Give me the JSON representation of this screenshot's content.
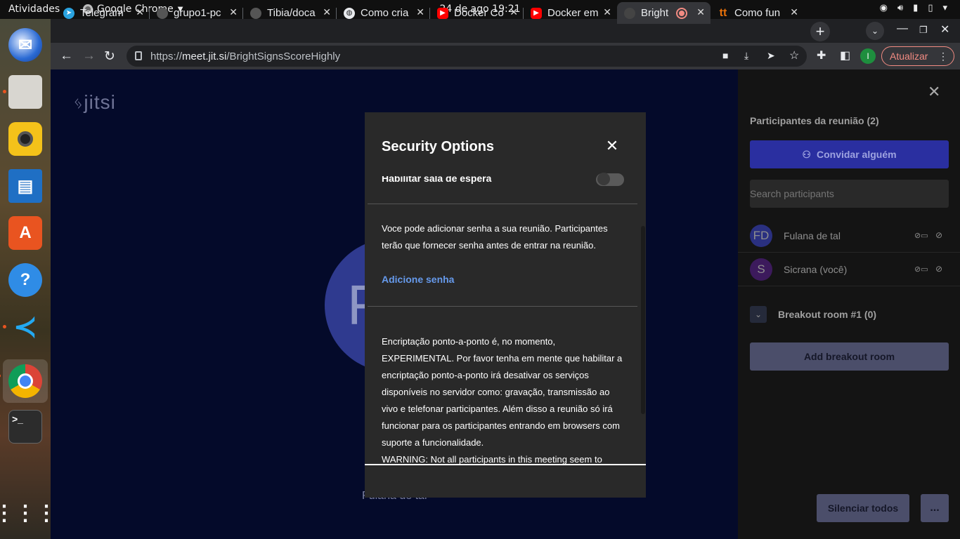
{
  "topbar": {
    "activities": "Atividades",
    "app_name": "Google Chrome",
    "clock": "24 de ago  19:21",
    "icons": [
      "wifi-icon",
      "volume-icon",
      "microphone-icon",
      "battery-icon",
      "power-menu-icon"
    ]
  },
  "dock": {
    "items": [
      "thunderbird",
      "files",
      "rhythmbox",
      "libreoffice-writer",
      "ubuntu-software",
      "help",
      "vscode",
      "chrome",
      "terminal",
      "show-apps"
    ]
  },
  "browser": {
    "tabs": [
      {
        "title": "Telegram",
        "icon": "telegram-icon",
        "icon_color": "#2aa3e0"
      },
      {
        "title": "grupo1-pc",
        "icon": "github-icon",
        "icon_color": "#555555"
      },
      {
        "title": "Tibia/doca",
        "icon": "github-icon",
        "icon_color": "#555555"
      },
      {
        "title": "Como cria",
        "icon": "globe-icon",
        "icon_color": "#e8eaed"
      },
      {
        "title": "Docker Co",
        "icon": "youtube-icon",
        "icon_color": "#ff0000"
      },
      {
        "title": "Docker em",
        "icon": "youtube-icon",
        "icon_color": "#ff0000"
      },
      {
        "title": "Bright",
        "icon": "jitsi-icon",
        "icon_color": "#444444",
        "active": true,
        "recording": true
      },
      {
        "title": "Como fun",
        "icon": "tt-icon",
        "icon_color": "#e8710a"
      }
    ],
    "url_scheme": "https://",
    "url_host": "meet.jit.si",
    "url_path": "/BrightSignsScoreHighly",
    "profile_initial": "I",
    "update_label": "Atualizar"
  },
  "meeting": {
    "logo": "jitsi",
    "avatar_initial": "F",
    "tile_name": "Fulana de tal"
  },
  "security_dialog": {
    "title": "Security Options",
    "lobby_label": "Habilitar sala de espera",
    "lobby_enabled": false,
    "password_text": "Voce pode adicionar senha a sua reunião. Participantes terão que fornecer senha antes de entrar na reunião.",
    "add_password": "Adicione senha",
    "e2ee_text": "Encriptação ponto-a-ponto é, no momento, EXPERIMENTAL. Por favor tenha em mente que habilitar a encriptação ponto-a-ponto irá desativar os serviços disponíveis no servidor como: gravação, transmissão ao vivo e telefonar participantes. Além disso a reunião só irá funcionar para os participantes entrando em browsers com suporte a funcionalidade.",
    "warning_text": "WARNING: Not all participants in this meeting seem to"
  },
  "participants_panel": {
    "title": "Participantes da reunião (2)",
    "invite_label": "Convidar alguém",
    "search_placeholder": "Search participants",
    "participants": [
      {
        "initials": "FD",
        "name": "Fulana de tal",
        "avatar_color": "#2a3080"
      },
      {
        "initials": "S",
        "name": "Sicrana (você)",
        "avatar_color": "#3c1a5c"
      }
    ],
    "breakout_room": "Breakout room #1 (0)",
    "add_breakout_label": "Add breakout room",
    "mute_all_label": "Silenciar todos",
    "more_label": "..."
  }
}
